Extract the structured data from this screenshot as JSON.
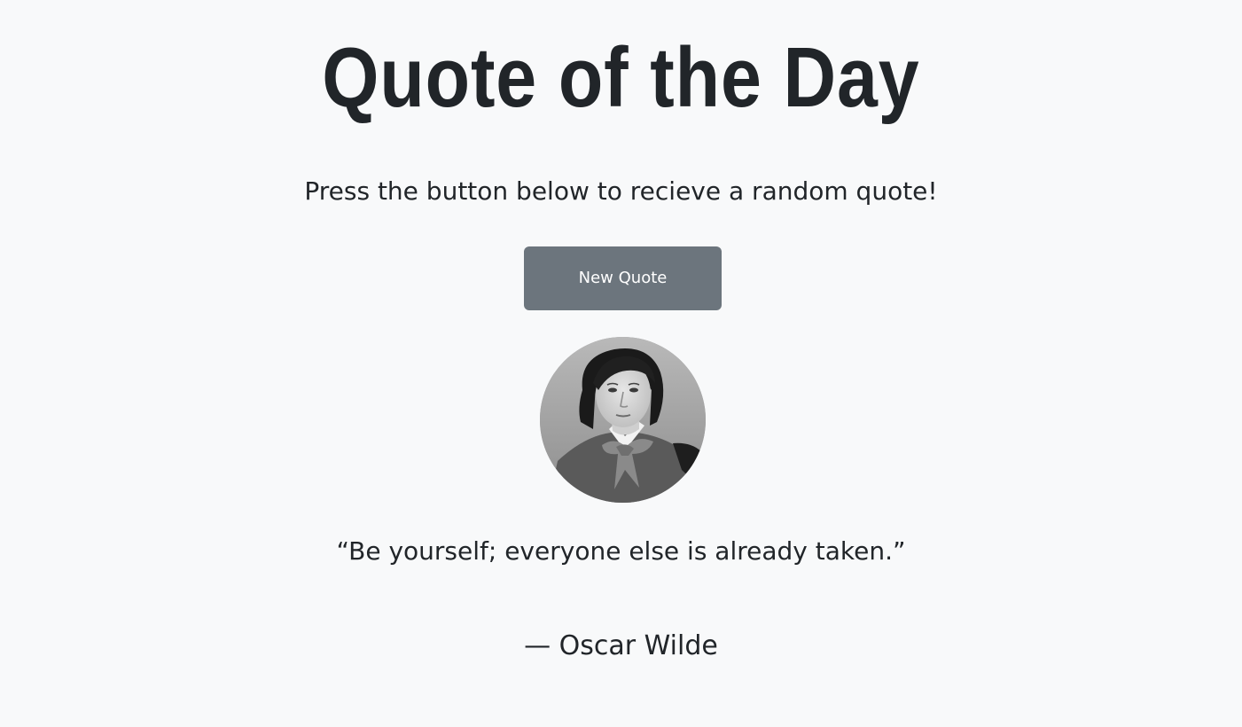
{
  "header": {
    "title": "Quote of the Day",
    "subtitle": "Press the button below to recieve a random quote!"
  },
  "actions": {
    "new_quote_label": "New Quote"
  },
  "quote": {
    "text": "“Be yourself; everyone else is already taken.”",
    "author": "— Oscar Wilde",
    "portrait_icon": "author-portrait"
  },
  "colors": {
    "background": "#f8f9fa",
    "text": "#212529",
    "button": "#6c757d",
    "button_text": "#ffffff"
  }
}
